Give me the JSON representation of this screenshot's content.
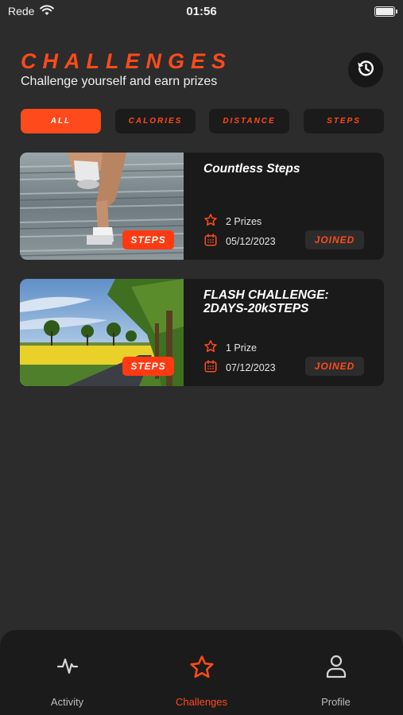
{
  "status_bar": {
    "carrier": "Rede",
    "time": "01:56"
  },
  "header": {
    "title": "CHALLENGES",
    "subtitle": "Challenge yourself and earn prizes",
    "history_icon": "history-icon"
  },
  "filters": [
    {
      "label": "ALL",
      "active": true
    },
    {
      "label": "CALORIES",
      "active": false
    },
    {
      "label": "DISTANCE",
      "active": false
    },
    {
      "label": "STEPS",
      "active": false
    }
  ],
  "challenges": [
    {
      "title": "Countless Steps",
      "tag": "STEPS",
      "prizes": "2 Prizes",
      "date": "05/12/2023",
      "status": "JOINED",
      "image": "runner-feet-photo"
    },
    {
      "title": "FLASH CHALLENGE: 2DAYS-20kSTEPS",
      "tag": "STEPS",
      "prizes": "1 Prize",
      "date": "07/12/2023",
      "status": "JOINED",
      "image": "road-trees-field-photo"
    }
  ],
  "nav": [
    {
      "label": "Activity",
      "icon": "activity-icon",
      "active": false
    },
    {
      "label": "Challenges",
      "icon": "star-icon",
      "active": true
    },
    {
      "label": "Profile",
      "icon": "user-icon",
      "active": false
    }
  ],
  "colors": {
    "accent": "#ff4a1c",
    "background": "#2c2c2c",
    "card": "#1a1a1a"
  }
}
